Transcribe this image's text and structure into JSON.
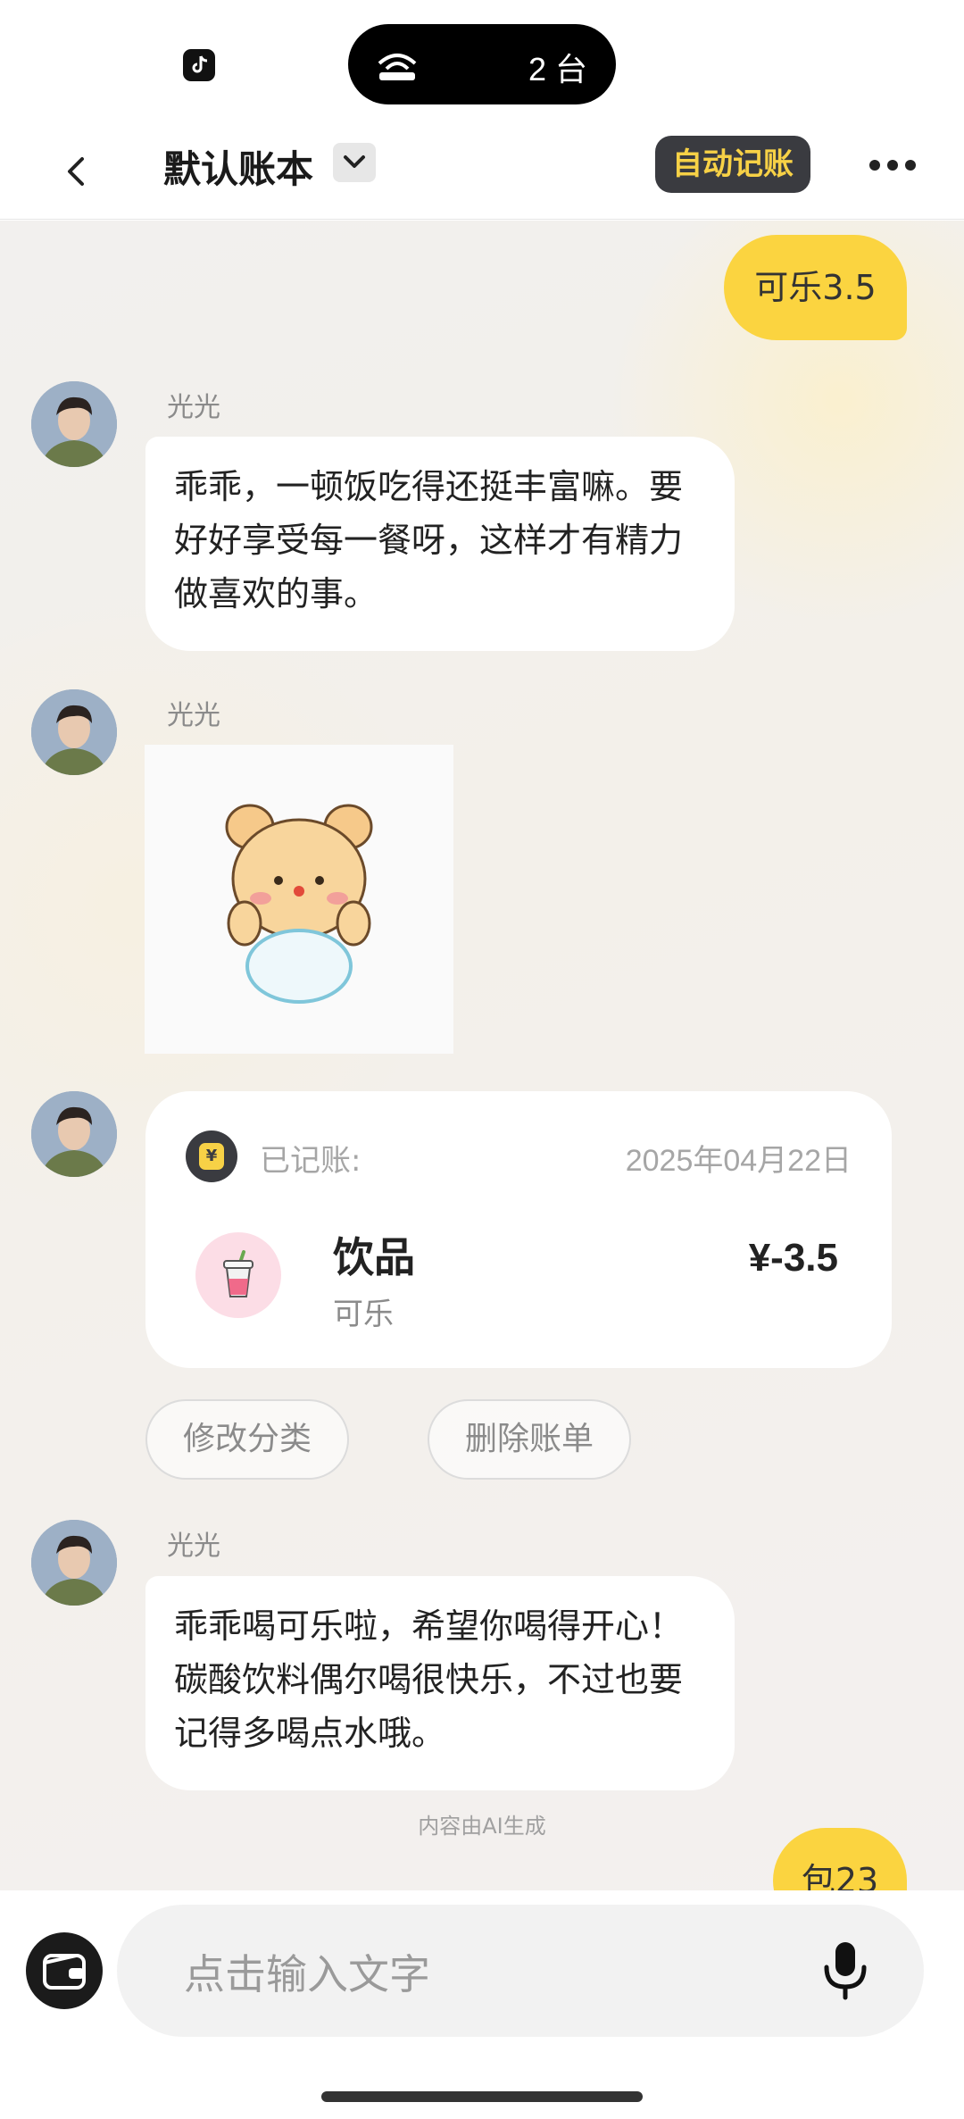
{
  "status_bar": {
    "cast_count": "2 台"
  },
  "header": {
    "title": "默认账本",
    "auto_button": "自动记账"
  },
  "messages": {
    "user_1": "可乐3.5",
    "sender_name": "光光",
    "bot_1": "乖乖，一顿饭吃得还挺丰富嘛。要好好享受每一餐呀，这样才有精力做喜欢的事。",
    "record": {
      "label": "已记账:",
      "date": "2025年04月22日",
      "category": "饮品",
      "note": "可乐",
      "amount": "¥-3.5",
      "icon_symbol": "¥"
    },
    "actions": {
      "modify": "修改分类",
      "delete": "删除账单"
    },
    "bot_2": "乖乖喝可乐啦，希望你喝得开心！碳酸饮料偶尔喝很快乐，不过也要记得多喝点水哦。",
    "ai_note": "内容由AI生成",
    "user_2_partial": "包23"
  },
  "input": {
    "placeholder": "点击输入文字"
  },
  "colors": {
    "accent_yellow": "#fbd440",
    "dark_button": "#3a3b40",
    "auto_text": "#f7d146"
  }
}
